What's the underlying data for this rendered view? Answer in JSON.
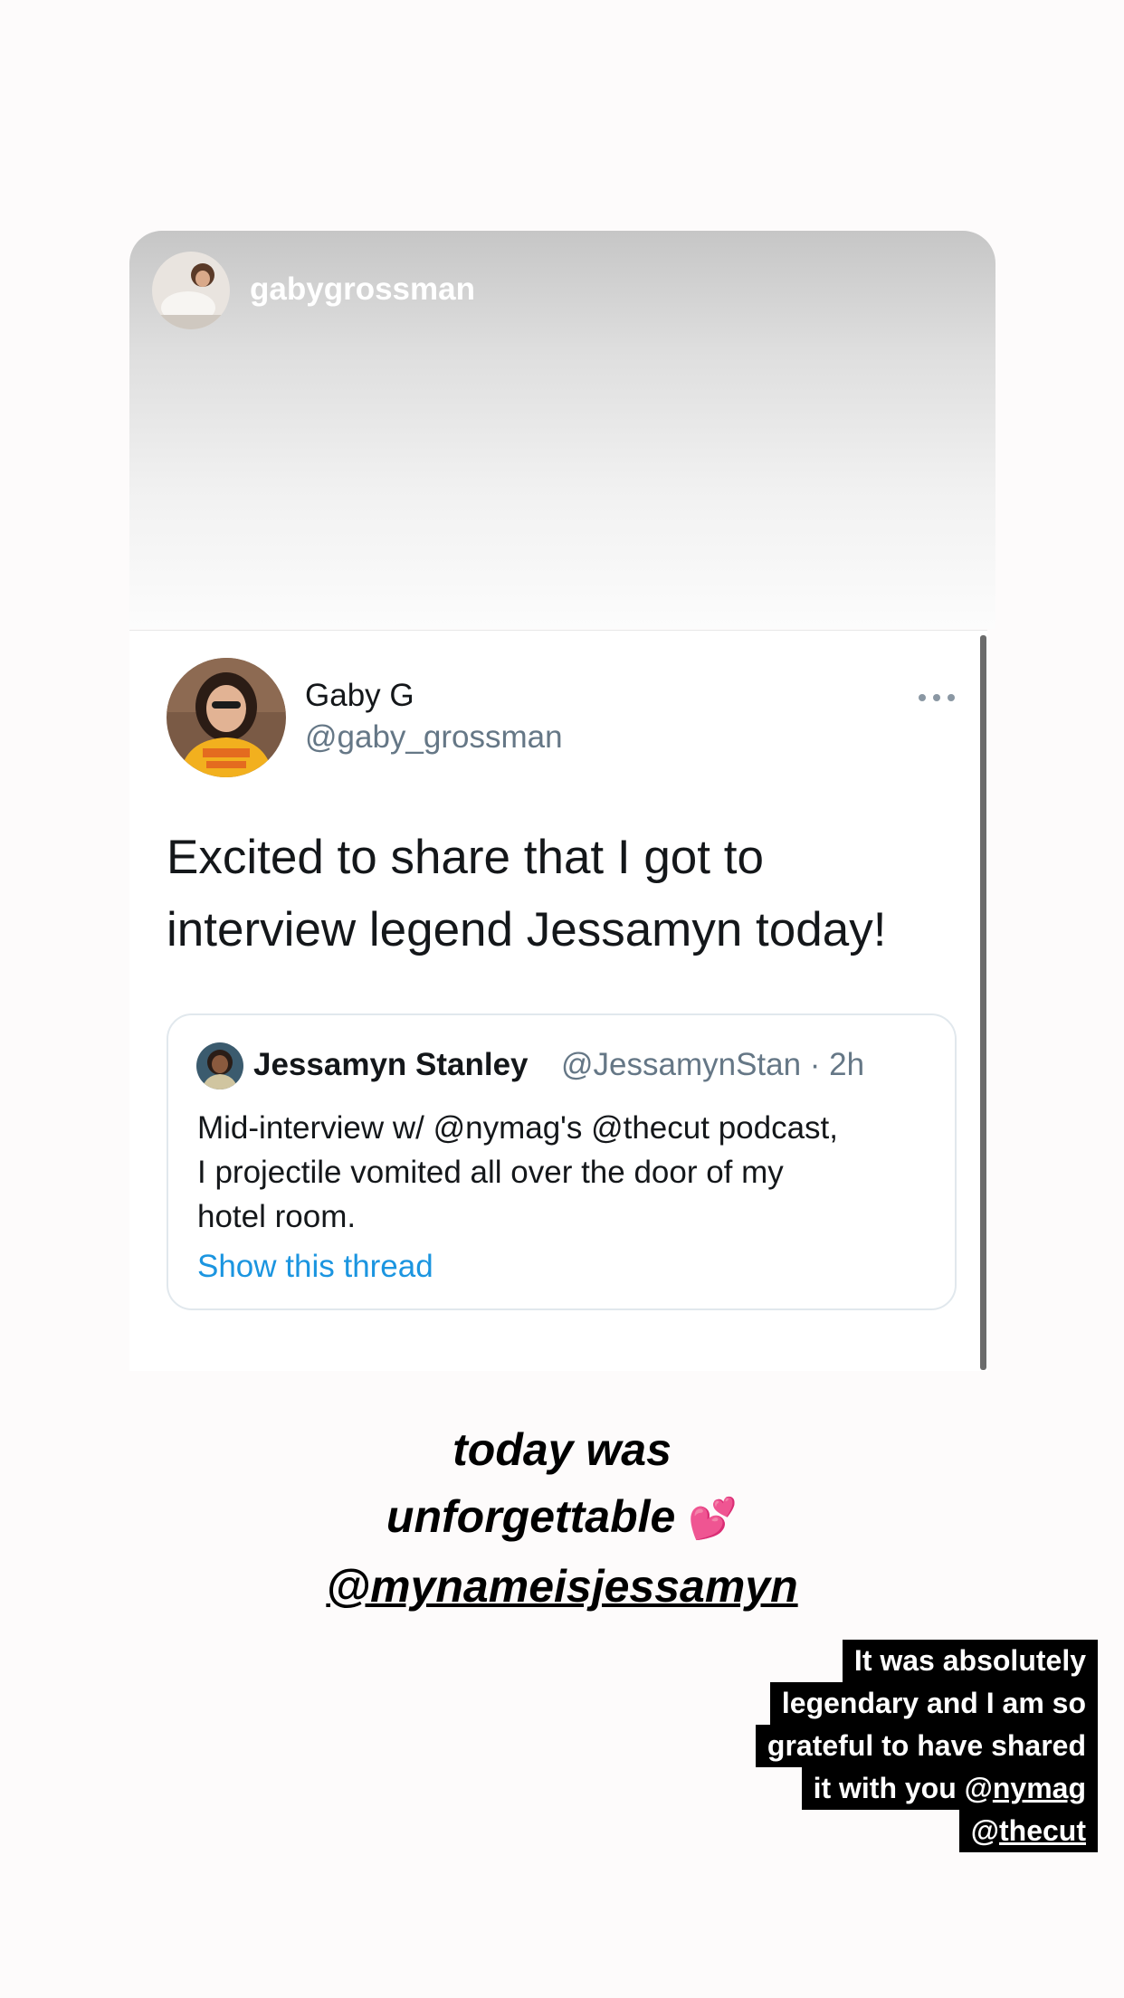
{
  "story": {
    "username": "gabygrossman"
  },
  "tweet": {
    "name": "Gaby G",
    "handle": "@gaby_grossman",
    "text_line1": "Excited to share that I got to",
    "text_line2": "interview legend Jessamyn today!",
    "more_icon": "more-horizontal-icon",
    "quoted": {
      "name": "Jessamyn Stanley",
      "handle_time": "@JessamynStan · 2h",
      "text_line1": "Mid-interview w/ @nymag's @thecut podcast,",
      "text_line2": "I projectile vomited all over the door of my",
      "text_line3": "hotel room.",
      "link": "Show this thread"
    }
  },
  "caption": {
    "line1": "today was",
    "line2": "unforgettable",
    "emoji": "💕",
    "mention": "@mynameisjessamyn"
  },
  "reply": {
    "line1": "It was absolutely",
    "line2": "legendary and I am so",
    "line3": "grateful to have shared",
    "line4_prefix": "it with you @",
    "line4_mention": "nymag",
    "line5_prefix": "@",
    "line5_mention": "thecut"
  },
  "colors": {
    "link_blue": "#1b95e0",
    "handle_gray": "#657786",
    "heart_pink": "#ff5fa8"
  }
}
